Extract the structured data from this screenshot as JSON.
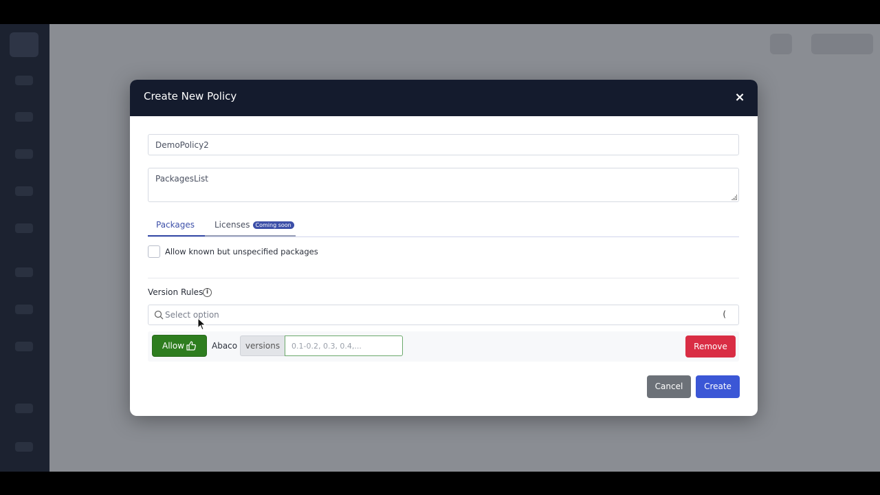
{
  "modal": {
    "title": "Create New Policy",
    "close_label": "×"
  },
  "form": {
    "name_value": "DemoPolicy2",
    "description_value": "PackagesList"
  },
  "tabs": [
    {
      "label": "Packages",
      "active": true
    },
    {
      "label": "Licenses",
      "badge": "Coming soon",
      "active": false
    }
  ],
  "options": {
    "allow_unspecified_label": "Allow known but unspecified packages",
    "allow_unspecified_checked": false
  },
  "version_rules": {
    "title": "Version Rules",
    "info_icon": "i",
    "select_placeholder": "Select option",
    "loading_glyph": "(",
    "rules": [
      {
        "action_label": "Allow",
        "package": "Abaco",
        "versions_label": "versions",
        "versions_placeholder": "0.1-0.2, 0.3, 0.4,...",
        "remove_label": "Remove"
      }
    ]
  },
  "footer": {
    "cancel_label": "Cancel",
    "create_label": "Create"
  },
  "colors": {
    "header_bg": "#141b2d",
    "accent": "#3c4fa8",
    "allow_green": "#2e7d1f",
    "remove_red": "#d92d44",
    "create_blue": "#3b57d6",
    "cancel_gray": "#6c7178"
  }
}
